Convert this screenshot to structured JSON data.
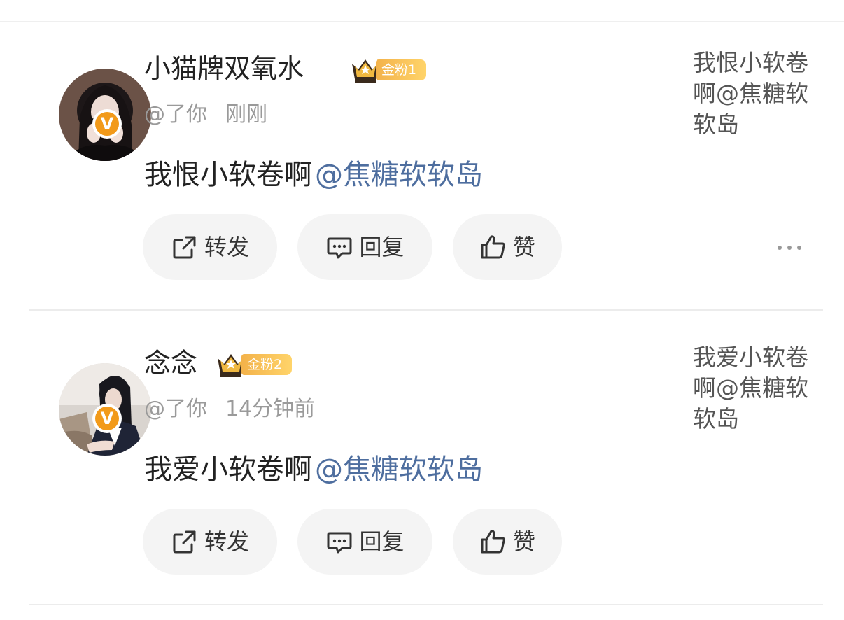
{
  "posts": [
    {
      "username": "小猫牌双氧水",
      "fan_badge": "金粉1",
      "handle": "@了你",
      "time": "刚刚",
      "content_text": "我恨小软卷啊",
      "content_mention": "@焦糖软软岛",
      "side_text": "我恨小软卷啊@焦糖软软岛",
      "actions": {
        "repost": "转发",
        "reply": "回复",
        "like": "赞"
      }
    },
    {
      "username": "念念",
      "fan_badge": "金粉2",
      "handle": "@了你",
      "time": "14分钟前",
      "content_text": "我爱小软卷啊",
      "content_mention": "@焦糖软软岛",
      "side_text": "我爱小软卷啊@焦糖软软岛",
      "actions": {
        "repost": "转发",
        "reply": "回复",
        "like": "赞"
      }
    }
  ],
  "verified_badge": "V",
  "colors": {
    "mention": "#4e6e9f",
    "fan_badge": "#f3b24a",
    "verified": "#f29a1a",
    "button_bg": "#f4f4f4"
  }
}
